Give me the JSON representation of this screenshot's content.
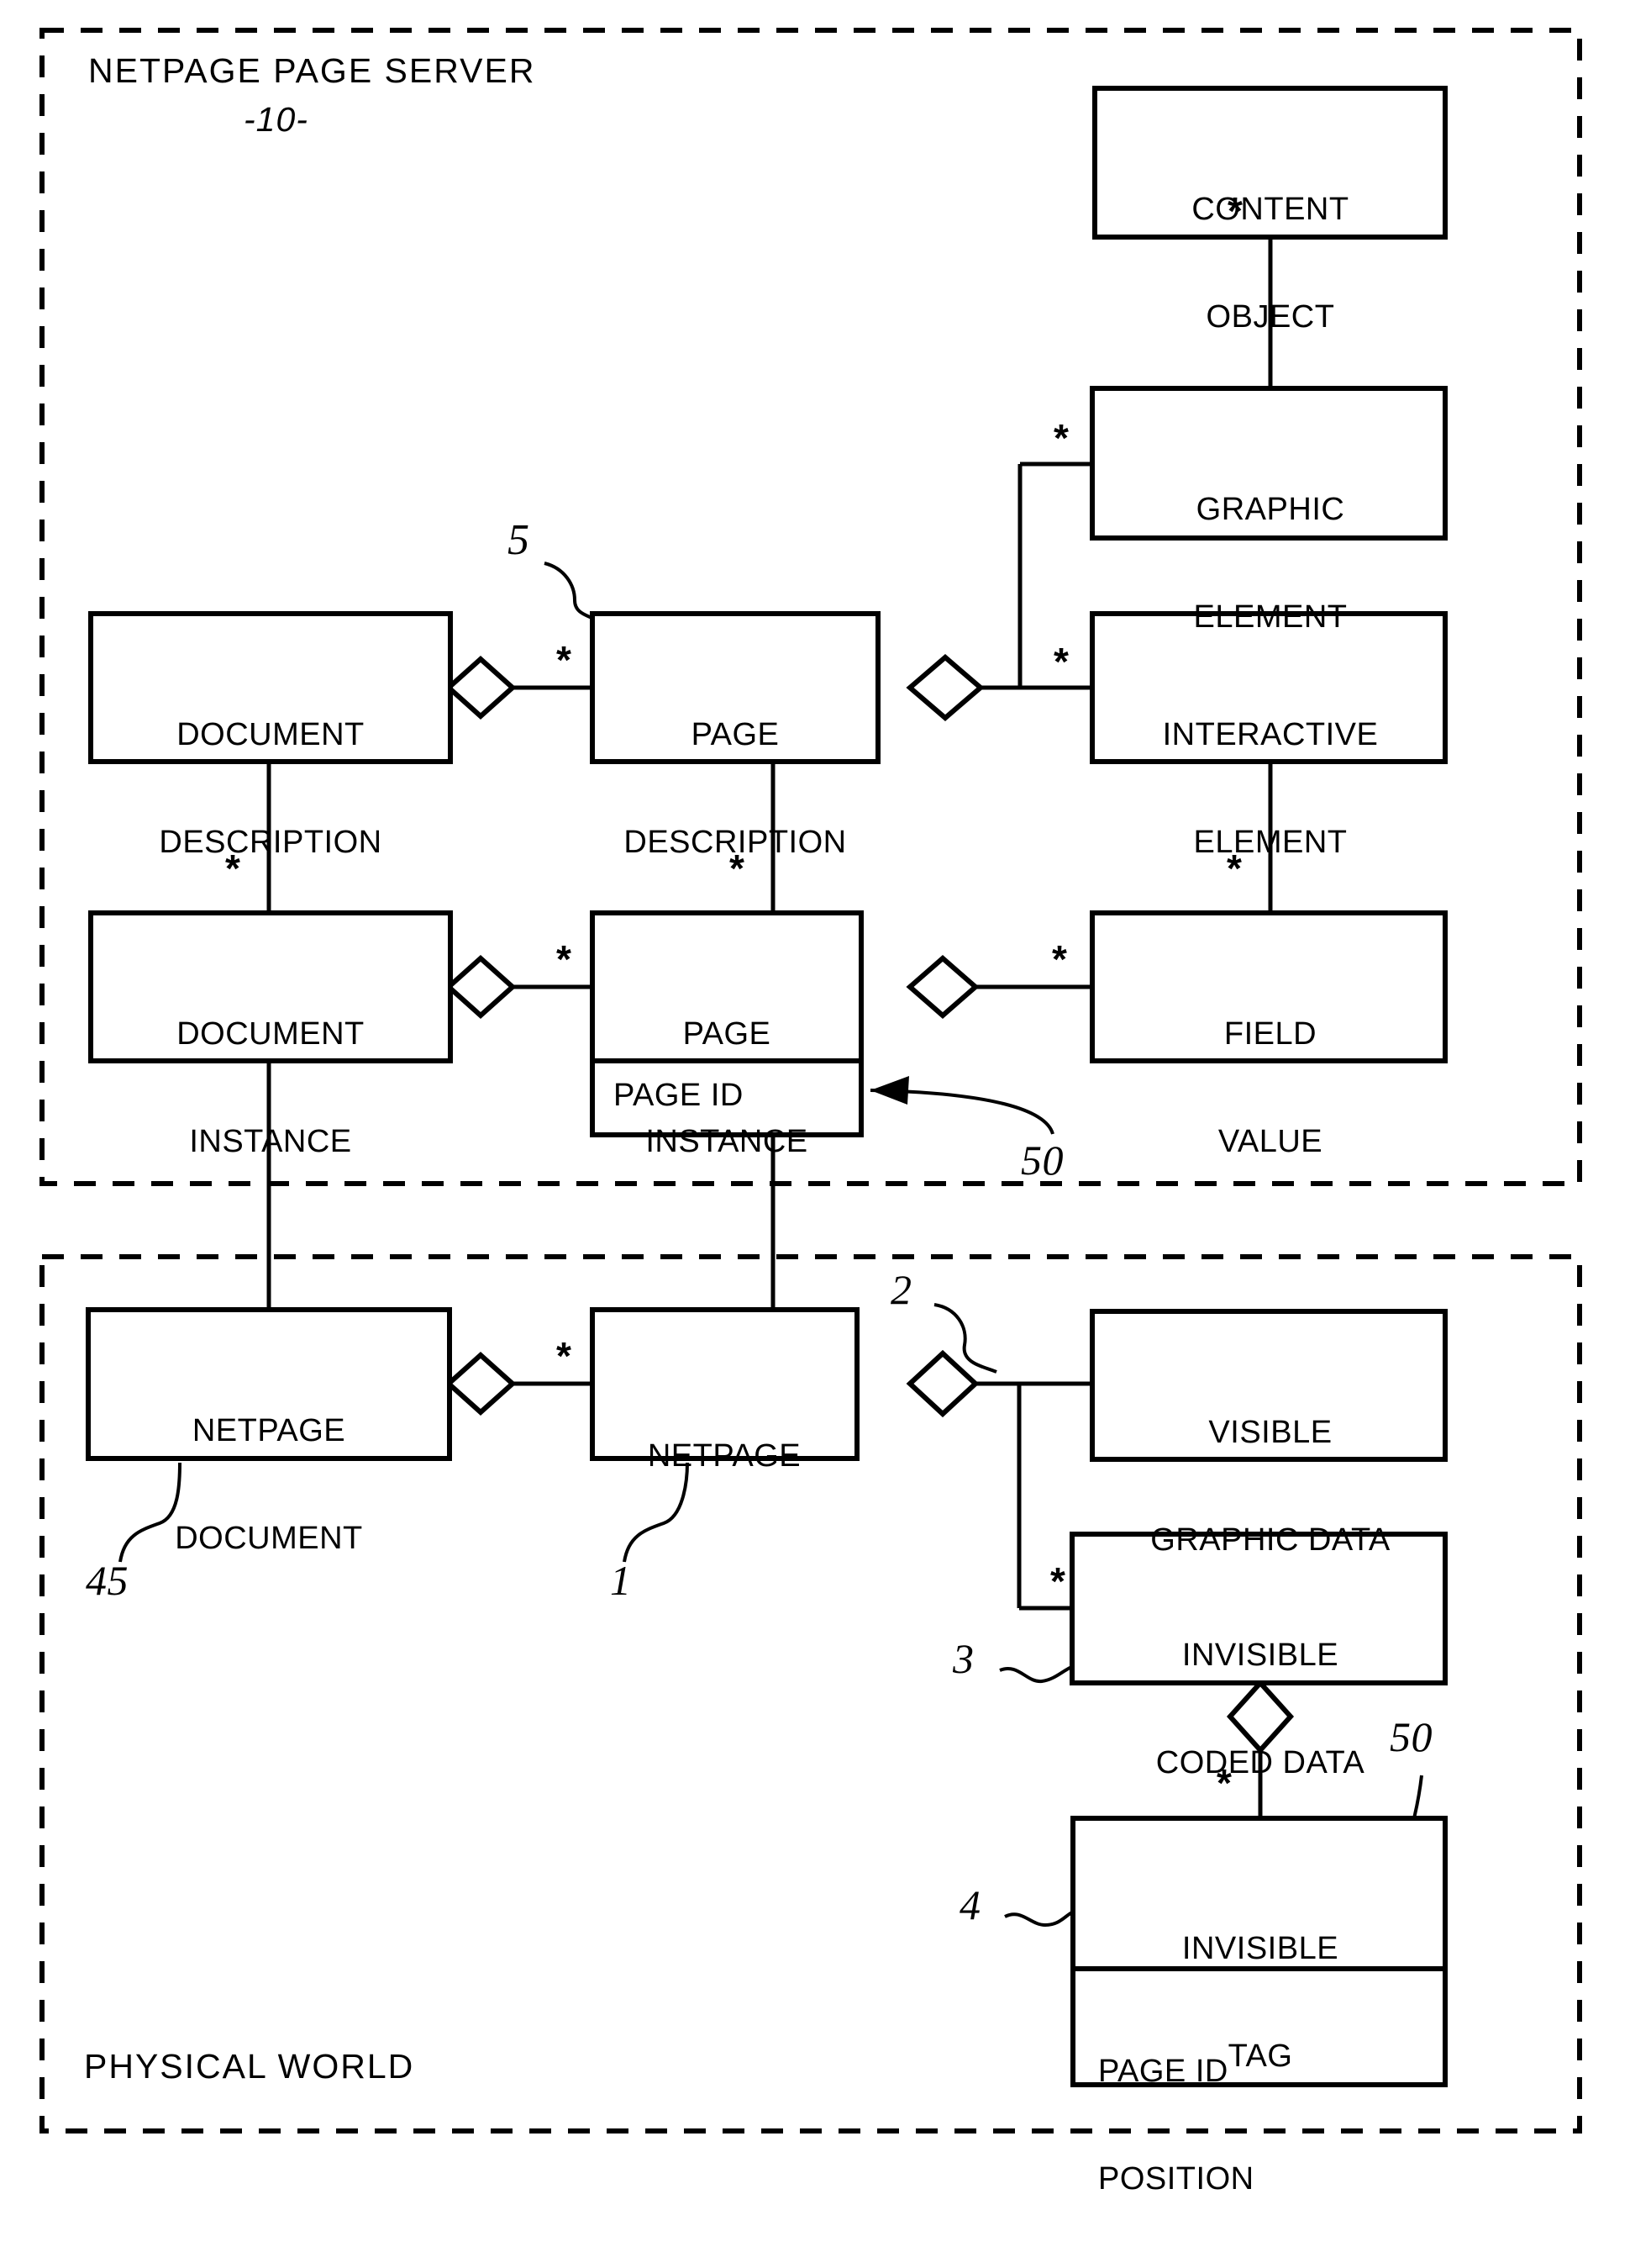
{
  "figure": {
    "type": "uml-class-diagram",
    "panels": [
      {
        "id": "netpage-page-server",
        "title": "NETPAGE PAGE SERVER",
        "subtitle": "-10-",
        "title_position": "top-left"
      },
      {
        "id": "physical-world",
        "title": "PHYSICAL WORLD",
        "title_position": "bottom-left"
      }
    ]
  },
  "boxes": {
    "content_object": {
      "lines": [
        "CONTENT",
        "OBJECT"
      ]
    },
    "graphic_element": {
      "lines": [
        "GRAPHIC",
        "ELEMENT"
      ]
    },
    "interactive_element": {
      "lines": [
        "INTERACTIVE",
        "ELEMENT"
      ]
    },
    "document_description": {
      "lines": [
        "DOCUMENT",
        "DESCRIPTION"
      ]
    },
    "page_description": {
      "lines": [
        "PAGE",
        "DESCRIPTION"
      ]
    },
    "document_instance": {
      "lines": [
        "DOCUMENT",
        "INSTANCE"
      ]
    },
    "page_instance": {
      "lines": [
        "PAGE",
        "INSTANCE"
      ],
      "compartment": [
        "PAGE ID"
      ]
    },
    "field_value": {
      "lines": [
        "FIELD",
        "VALUE"
      ]
    },
    "netpage_document": {
      "lines": [
        "NETPAGE",
        "DOCUMENT"
      ]
    },
    "netpage": {
      "lines": [
        "NETPAGE"
      ]
    },
    "visible_graphic_data": {
      "lines": [
        "VISIBLE",
        "GRAPHIC DATA"
      ]
    },
    "invisible_coded_data": {
      "lines": [
        "INVISIBLE",
        "CODED DATA"
      ]
    },
    "invisible_tag": {
      "lines": [
        "INVISIBLE",
        "TAG"
      ],
      "compartment": [
        "PAGE ID",
        "POSITION"
      ]
    }
  },
  "reference_numerals": {
    "page_description_ref": "5",
    "page_id_ref_server": "50",
    "netpage_document_ref": "45",
    "netpage_ref": "1",
    "visible_graphic_data_ref": "2",
    "invisible_coded_data_ref": "3",
    "invisible_tag_ref": "4",
    "page_id_position_ref": "50"
  },
  "multiplicities": {
    "content_object_to_graphic_element": "*",
    "page_description_to_graphic_element": "*",
    "page_description_to_interactive_element": "*",
    "document_description_to_page_description": "*",
    "document_description_to_document_instance": "*",
    "page_description_to_page_instance": "*",
    "interactive_element_to_field_value": "*",
    "document_instance_to_page_instance": "*",
    "page_instance_to_field_value": "*",
    "netpage_document_to_netpage": "*",
    "netpage_to_invisible_coded_data": "*",
    "invisible_coded_data_to_invisible_tag": "*"
  },
  "colors": {
    "line": "#000000",
    "fill": "#ffffff",
    "text": "#000000"
  }
}
